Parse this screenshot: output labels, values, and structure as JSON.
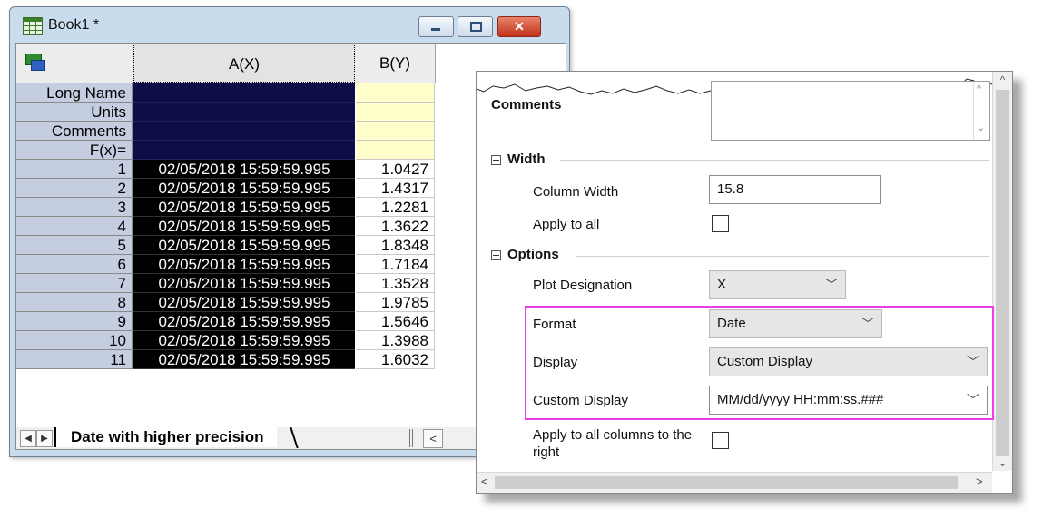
{
  "book": {
    "title": "Book1 *",
    "columns": {
      "a": "A(X)",
      "b": "B(Y)"
    },
    "meta_rows": [
      "Long Name",
      "Units",
      "Comments",
      "F(x)="
    ],
    "rows": [
      {
        "n": "1",
        "a": "02/05/2018 15:59:59.995",
        "b": "1.0427"
      },
      {
        "n": "2",
        "a": "02/05/2018 15:59:59.995",
        "b": "1.4317"
      },
      {
        "n": "3",
        "a": "02/05/2018 15:59:59.995",
        "b": "1.2281"
      },
      {
        "n": "4",
        "a": "02/05/2018 15:59:59.995",
        "b": "1.3622"
      },
      {
        "n": "5",
        "a": "02/05/2018 15:59:59.995",
        "b": "1.8348"
      },
      {
        "n": "6",
        "a": "02/05/2018 15:59:59.995",
        "b": "1.7184"
      },
      {
        "n": "7",
        "a": "02/05/2018 15:59:59.995",
        "b": "1.3528"
      },
      {
        "n": "8",
        "a": "02/05/2018 15:59:59.995",
        "b": "1.9785"
      },
      {
        "n": "9",
        "a": "02/05/2018 15:59:59.995",
        "b": "1.5646"
      },
      {
        "n": "10",
        "a": "02/05/2018 15:59:59.995",
        "b": "1.3988"
      },
      {
        "n": "11",
        "a": "02/05/2018 15:59:59.995",
        "b": "1.6032"
      }
    ],
    "sheet_tab": "Date with higher precision",
    "nav_prev": "◀",
    "nav_next": "▶",
    "hscroll_left": "<"
  },
  "panel": {
    "comments_label": "Comments",
    "width_section": "Width",
    "column_width_label": "Column Width",
    "column_width_value": "15.8",
    "apply_to_all_label": "Apply to all",
    "options_section": "Options",
    "plot_designation_label": "Plot Designation",
    "plot_designation_value": "X",
    "format_label": "Format",
    "format_value": "Date",
    "display_label": "Display",
    "display_value": "Custom Display",
    "custom_display_label": "Custom Display",
    "custom_display_value": "MM/dd/yyyy HH:mm:ss.###",
    "apply_right_label": "Apply to all columns to the right",
    "chevron": "﹀",
    "scroll_left": "<",
    "scroll_right": ">",
    "scroll_up": "^",
    "scroll_down": "⌄"
  },
  "colors": {
    "highlight": "#ee3ce6",
    "selected_column": "#000000",
    "meta_yellow": "#ffffcc",
    "row_header": "#c5cde0"
  }
}
